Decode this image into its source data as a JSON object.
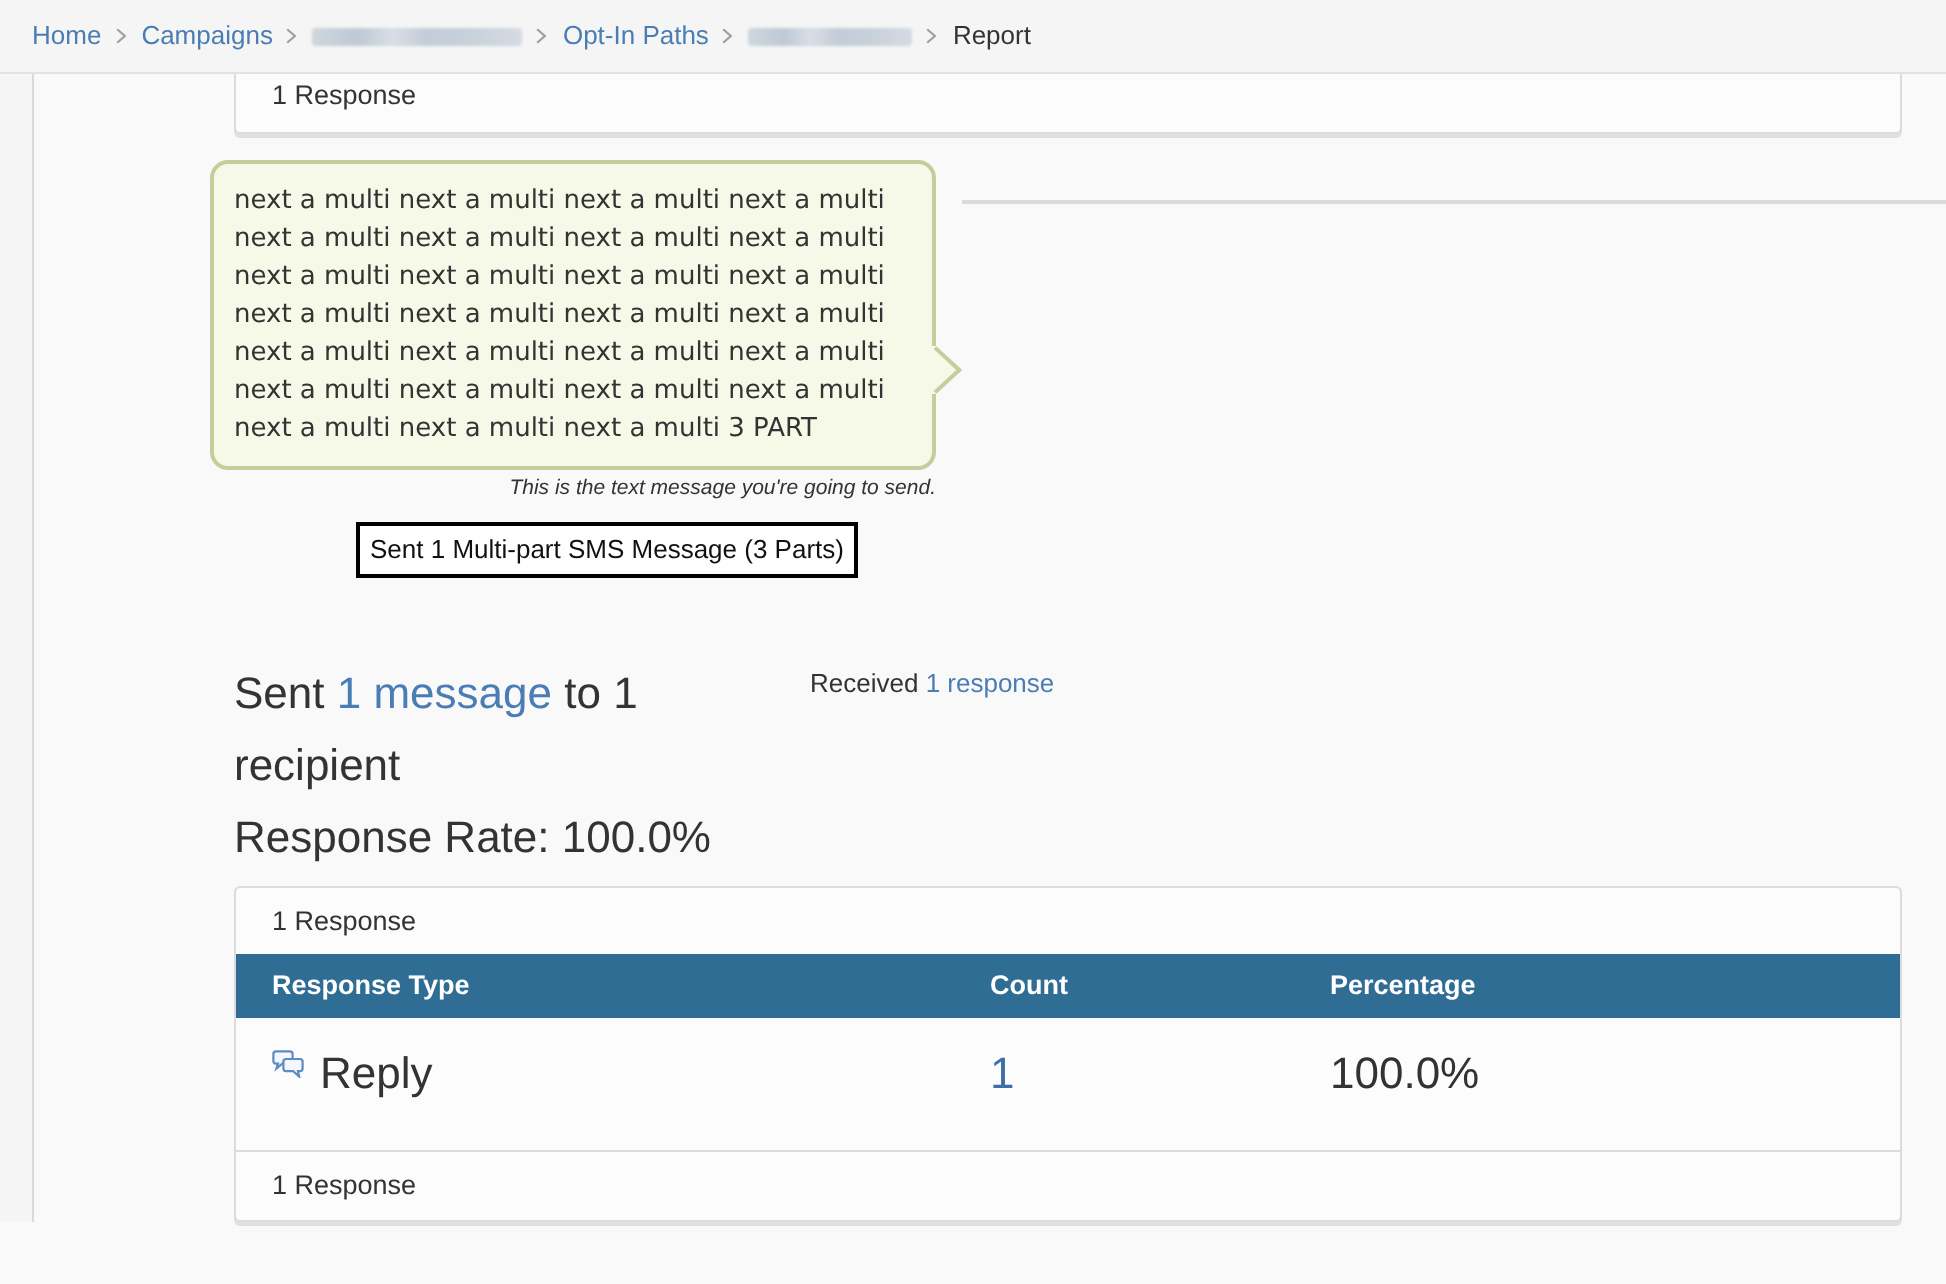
{
  "breadcrumb": [
    {
      "kind": "link",
      "label": "Home"
    },
    {
      "kind": "link",
      "label": "Campaigns"
    },
    {
      "kind": "redacted"
    },
    {
      "kind": "link",
      "label": "Opt-In Paths"
    },
    {
      "kind": "redacted"
    },
    {
      "kind": "current",
      "label": "Report"
    }
  ],
  "top_panel": {
    "footer": "1 Response"
  },
  "message": {
    "text": "next a multi next a multi next a multi next a multi next a multi next a multi next a multi next a multi next a multi next a multi next a multi next a multi next a multi next a multi next a multi next a multi next a multi next a multi next a multi next a multi next a multi next a multi next a multi next a multi next a multi next a multi next a multi 3 PART",
    "caption": "This is the text message you're going to send.",
    "sent_label": "Sent 1 Multi-part SMS Message (3 Parts)"
  },
  "summary": {
    "sent": {
      "prefix": "Sent",
      "link": "1 message",
      "suffix": "to 1 recipient"
    },
    "rate": "Response Rate: 100.0%",
    "received": {
      "prefix": "Received",
      "link": "1 response"
    }
  },
  "responses": {
    "header_note": "1 Response",
    "columns": [
      "Response Type",
      "Count",
      "Percentage"
    ],
    "rows": [
      {
        "kind": "reply",
        "type": "Reply",
        "count": "1",
        "percentage": "100.0%"
      }
    ],
    "footer": "1 Response"
  }
}
